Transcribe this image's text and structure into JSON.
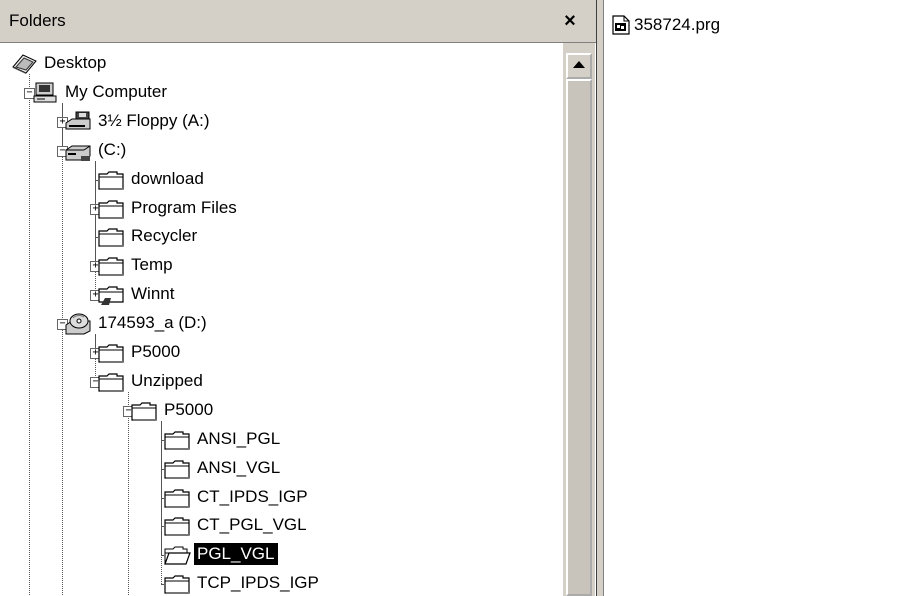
{
  "folders_pane": {
    "title": "Folders",
    "close_glyph": "×"
  },
  "tree": [
    {
      "label": "Desktop",
      "icon": "desktop-icon",
      "level": 0,
      "expander": null,
      "selected": false
    },
    {
      "label": "My Computer",
      "icon": "computer-icon",
      "level": 1,
      "expander": "minus",
      "selected": false
    },
    {
      "label": "3½ Floppy (A:)",
      "icon": "floppy-drive-icon",
      "level": 2,
      "expander": "plus",
      "selected": false
    },
    {
      "label": "(C:)",
      "icon": "hard-drive-icon",
      "level": 2,
      "expander": "minus",
      "selected": false
    },
    {
      "label": "download",
      "icon": "folder-icon",
      "level": 3,
      "expander": null,
      "selected": false
    },
    {
      "label": "Program Files",
      "icon": "folder-icon",
      "level": 3,
      "expander": "plus",
      "selected": false
    },
    {
      "label": "Recycler",
      "icon": "folder-icon",
      "level": 3,
      "expander": null,
      "selected": false
    },
    {
      "label": "Temp",
      "icon": "folder-icon",
      "level": 3,
      "expander": "plus",
      "selected": false
    },
    {
      "label": "Winnt",
      "icon": "shared-folder-icon",
      "level": 3,
      "expander": "plus",
      "selected": false
    },
    {
      "label": "174593_a (D:)",
      "icon": "cd-drive-icon",
      "level": 2,
      "expander": "minus",
      "selected": false
    },
    {
      "label": "P5000",
      "icon": "folder-icon",
      "level": 3,
      "expander": "plus",
      "selected": false
    },
    {
      "label": "Unzipped",
      "icon": "folder-icon",
      "level": 3,
      "expander": "minus",
      "selected": false
    },
    {
      "label": "P5000",
      "icon": "folder-icon",
      "level": 4,
      "expander": "minus",
      "selected": false
    },
    {
      "label": "ANSI_PGL",
      "icon": "folder-icon",
      "level": 5,
      "expander": null,
      "selected": false
    },
    {
      "label": "ANSI_VGL",
      "icon": "folder-icon",
      "level": 5,
      "expander": null,
      "selected": false
    },
    {
      "label": "CT_IPDS_IGP",
      "icon": "folder-icon",
      "level": 5,
      "expander": null,
      "selected": false
    },
    {
      "label": "CT_PGL_VGL",
      "icon": "folder-icon",
      "level": 5,
      "expander": null,
      "selected": false
    },
    {
      "label": "PGL_VGL",
      "icon": "open-folder-icon",
      "level": 5,
      "expander": null,
      "selected": true
    },
    {
      "label": "TCP_IPDS_IGP",
      "icon": "folder-icon",
      "level": 5,
      "expander": null,
      "selected": false
    }
  ],
  "file_list": {
    "items": [
      {
        "name": "358724.prg",
        "icon": "prg-file-icon"
      }
    ]
  },
  "colors": {
    "chrome": "#d4d0c8",
    "selection": "#000000",
    "selection_text": "#ffffff"
  }
}
